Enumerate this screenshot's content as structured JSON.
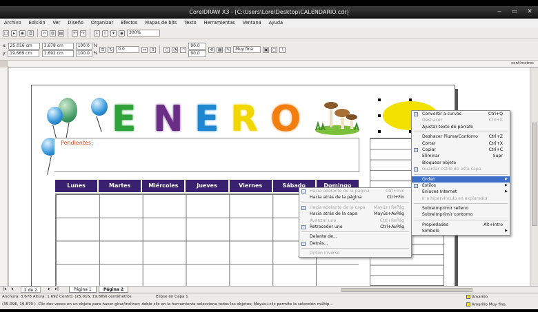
{
  "window": {
    "title": "CorelDRAW X3 - [C:\\Users\\Lore\\Desktop\\CALENDARIO.cdr]"
  },
  "menu": [
    "Archivo",
    "Edición",
    "Ver",
    "Diseño",
    "Organizar",
    "Efectos",
    "Mapas de bits",
    "Texto",
    "Herramientas",
    "Ventana",
    "Ayuda"
  ],
  "toolbar": {
    "zoom": "300%"
  },
  "property_bar": {
    "x": "25.016 cm",
    "y": "19.669 cm",
    "w": "3.678 cm",
    "h": "1.692 cm",
    "scale_w": "100.0",
    "scale_h": "100.0",
    "angle": "0.0",
    "corner_a": "90.0",
    "corner_b": "90.0",
    "outline": "Muy fina"
  },
  "ruler": {
    "unit": "centímetros"
  },
  "document": {
    "letters": [
      {
        "text": "E",
        "color": "#2fa33a"
      },
      {
        "text": "N",
        "color": "#6a2e86"
      },
      {
        "text": "E",
        "color": "#1f86d1"
      },
      {
        "text": "R",
        "color": "#f2d600"
      },
      {
        "text": "O",
        "color": "#f27e10"
      }
    ],
    "notes_label": "Pendientes:",
    "days": [
      "Lunes",
      "Martes",
      "Miércoles",
      "Jueves",
      "Viernes",
      "Sábado",
      "Domingo"
    ]
  },
  "context_menu": [
    {
      "label": "Convertir a curvas",
      "shortcut": "Ctrl+Q",
      "state": "normal"
    },
    {
      "label": "Deshacer",
      "shortcut": "Ctrl+K",
      "state": "disabled"
    },
    {
      "label": "Ajustar texto de párrafo",
      "shortcut": "",
      "state": "normal"
    },
    {
      "sep": true
    },
    {
      "label": "Deshacer Pluma/Contorno",
      "shortcut": "Ctrl+Z",
      "state": "normal"
    },
    {
      "label": "Cortar",
      "shortcut": "Ctrl+X",
      "state": "normal"
    },
    {
      "label": "Copiar",
      "shortcut": "Ctrl+C",
      "state": "normal"
    },
    {
      "label": "Eliminar",
      "shortcut": "Supr",
      "state": "normal"
    },
    {
      "label": "Bloquear objeto",
      "shortcut": "",
      "state": "normal"
    },
    {
      "label": "Guardar estilo de esta capa",
      "shortcut": "",
      "state": "disabled"
    },
    {
      "sep": true
    },
    {
      "label": "Orden",
      "shortcut": "",
      "state": "highlighted",
      "submenu": true
    },
    {
      "label": "Estilos",
      "shortcut": "",
      "state": "normal",
      "submenu": true
    },
    {
      "label": "Enlaces Internet",
      "shortcut": "",
      "state": "normal",
      "submenu": true
    },
    {
      "label": "Ir a hipervínculo en explorador",
      "shortcut": "",
      "state": "disabled"
    },
    {
      "sep": true
    },
    {
      "label": "Sobreimprimir relleno",
      "shortcut": "",
      "state": "normal"
    },
    {
      "label": "Sobreimprimir contorno",
      "shortcut": "",
      "state": "normal"
    },
    {
      "sep": true
    },
    {
      "label": "Propiedades",
      "shortcut": "Alt+Intro",
      "state": "normal"
    },
    {
      "label": "Símbolo",
      "shortcut": "",
      "state": "normal",
      "submenu": true
    }
  ],
  "submenu": [
    {
      "label": "Hacia adelante de la página",
      "shortcut": "Ctrl+Inic",
      "state": "disabled"
    },
    {
      "label": "Hacia atrás de la página",
      "shortcut": "Ctrl+Fin",
      "state": "normal"
    },
    {
      "sep": true
    },
    {
      "label": "Hacia adelante de la capa",
      "shortcut": "Mayús+RePág",
      "state": "disabled"
    },
    {
      "label": "Hacia atrás de la capa",
      "shortcut": "Mayús+AvPág",
      "state": "normal"
    },
    {
      "label": "Avanzar uno",
      "shortcut": "Ctrl+RePág",
      "state": "disabled"
    },
    {
      "label": "Retroceder uno",
      "shortcut": "Ctrl+AvPág",
      "state": "normal"
    },
    {
      "sep": true
    },
    {
      "label": "Delante de...",
      "shortcut": "",
      "state": "normal"
    },
    {
      "label": "Detrás...",
      "shortcut": "",
      "state": "normal"
    },
    {
      "sep": true
    },
    {
      "label": "Orden inverso",
      "shortcut": "",
      "state": "disabled"
    }
  ],
  "page_tabs": {
    "counter": "2 de 2",
    "tabs": [
      "Página 1",
      "Página 2"
    ],
    "active": 1
  },
  "status": {
    "dims": "Anchura: 3.678  Altura: 1.692  Centro: (25.016, 19.669)  centímetros",
    "object": "Elipse en Capa 1",
    "coords": "(35.096, 19.870 )",
    "hint": "Clic dos veces en un objeto para hacer girar/inclinar; doble clic en la herramienta selecciona todos los objetos; Mayús+clic permite la selección múltip...",
    "fill_color": "Amarillo",
    "outline_label": "Amarillo Muy fina"
  },
  "colors": {
    "menu_highlight": "#3d6fc8",
    "day_header": "#3a2170",
    "ellipse": "#f2e100",
    "notes_label": "#d24a1c"
  }
}
